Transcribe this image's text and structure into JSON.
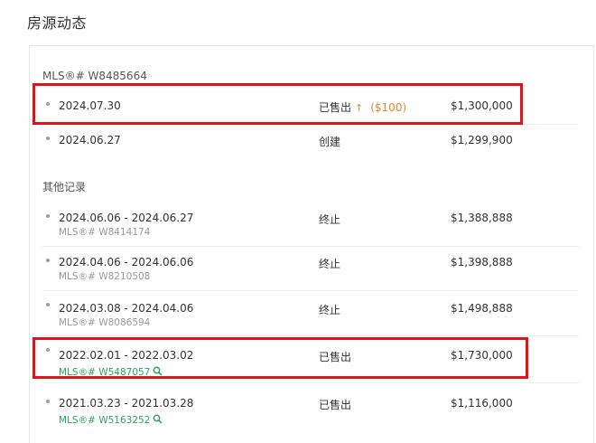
{
  "page_title": "房源动态",
  "current": {
    "mls": "MLS®# W8485664",
    "rows": [
      {
        "date": "2024.07.30",
        "status": "已售出",
        "arrow": "↑",
        "change": "($100)",
        "price": "$1,300,000"
      },
      {
        "date": "2024.06.27",
        "status": "创建",
        "price": "$1,299,900"
      }
    ]
  },
  "other": {
    "label": "其他记录",
    "rows": [
      {
        "date": "2024.06.06 - 2024.06.27",
        "mls": "MLS®# W8414174",
        "status": "终止",
        "price": "$1,388,888"
      },
      {
        "date": "2024.04.06 - 2024.06.06",
        "mls": "MLS®# W8210508",
        "status": "终止",
        "price": "$1,398,888"
      },
      {
        "date": "2024.03.08 - 2024.04.06",
        "mls": "MLS®# W8086594",
        "status": "终止",
        "price": "$1,498,888"
      },
      {
        "date": "2022.02.01 - 2022.03.02",
        "mls": "MLS®# W5487057",
        "status": "已售出",
        "price": "$1,730,000",
        "link": true
      },
      {
        "date": "2021.03.23 - 2021.03.28",
        "mls": "MLS®# W5163252",
        "status": "已售出",
        "price": "$1,116,000",
        "link": true
      }
    ]
  },
  "colors": {
    "highlight": "#e0141a",
    "accent_orange": "#e6862a",
    "link_green": "#2ca55c"
  },
  "icons": {
    "mls_link": "search-icon",
    "price_change": "arrow-up-icon"
  }
}
